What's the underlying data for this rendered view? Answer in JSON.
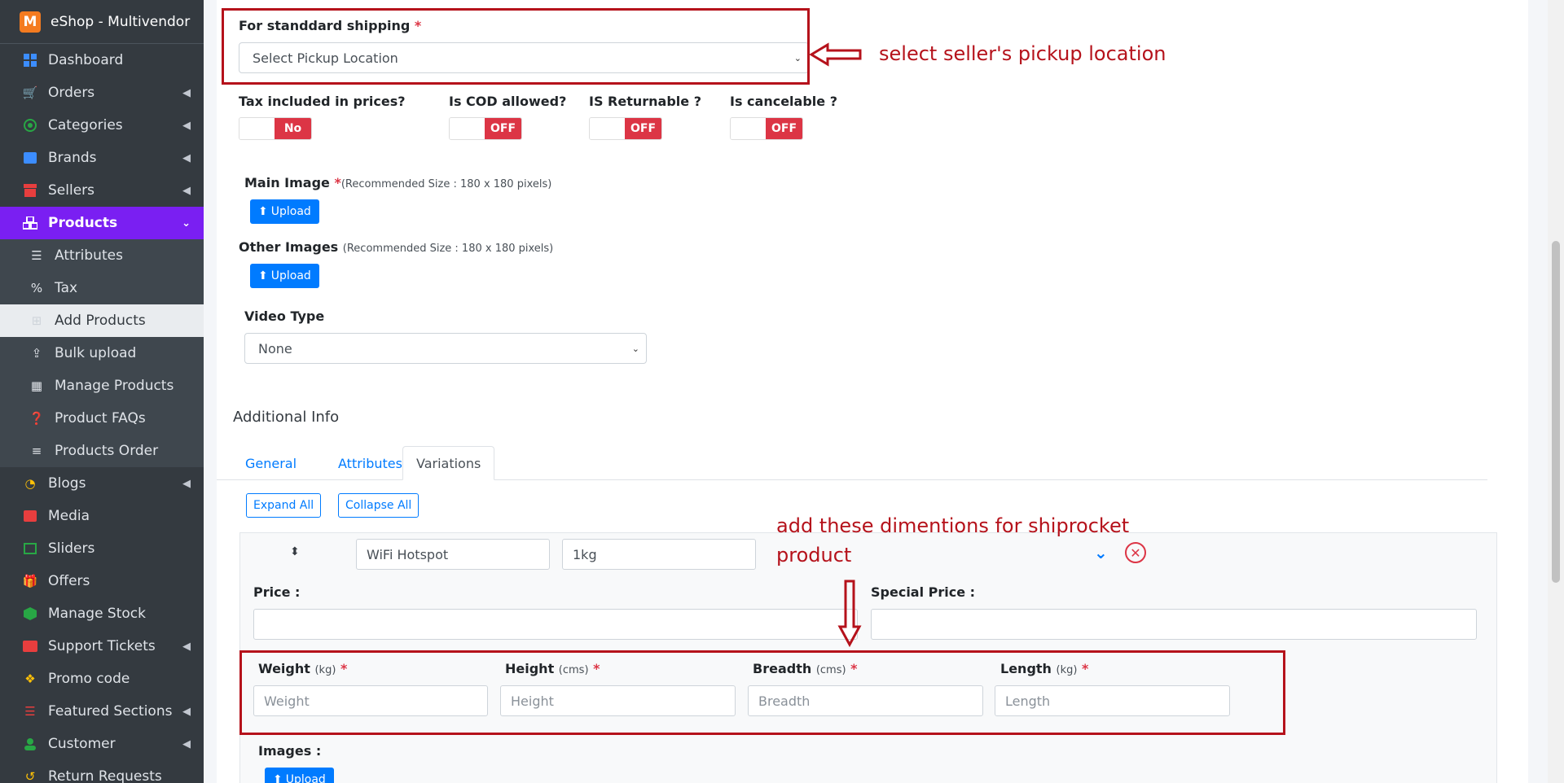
{
  "brand": {
    "title": "eShop - Multivendor",
    "logo_letter": "M"
  },
  "sidebar": {
    "items": [
      {
        "label": "Dashboard",
        "icon": "dashboard-icon"
      },
      {
        "label": "Orders",
        "icon": "cart-icon"
      },
      {
        "label": "Categories",
        "icon": "target-icon"
      },
      {
        "label": "Brands",
        "icon": "ad-icon"
      },
      {
        "label": "Sellers",
        "icon": "store-icon"
      },
      {
        "label": "Products",
        "icon": "cubes-icon"
      },
      {
        "label": "Attributes",
        "icon": "sliders-icon"
      },
      {
        "label": "Tax",
        "icon": "percent-icon"
      },
      {
        "label": "Add Products",
        "icon": "plus-square-icon"
      },
      {
        "label": "Bulk upload",
        "icon": "upload-icon"
      },
      {
        "label": "Manage Products",
        "icon": "boxes-icon"
      },
      {
        "label": "Product FAQs",
        "icon": "question-circle-icon"
      },
      {
        "label": "Products Order",
        "icon": "list-icon"
      },
      {
        "label": "Blogs",
        "icon": "blog-icon"
      },
      {
        "label": "Media",
        "icon": "photo-icon"
      },
      {
        "label": "Sliders",
        "icon": "image-icon"
      },
      {
        "label": "Offers",
        "icon": "gift-icon"
      },
      {
        "label": "Manage Stock",
        "icon": "cube-icon"
      },
      {
        "label": "Support Tickets",
        "icon": "ticket-icon"
      },
      {
        "label": "Promo code",
        "icon": "puzzle-icon"
      },
      {
        "label": "Featured Sections",
        "icon": "layers-icon"
      },
      {
        "label": "Customer",
        "icon": "user-icon"
      },
      {
        "label": "Return Requests",
        "icon": "undo-icon"
      }
    ]
  },
  "form": {
    "shipping_label": "For standdard shipping",
    "required_mark": "*",
    "pickup_select_value": "Select Pickup Location",
    "tax_label": "Tax included in prices?",
    "tax_value": "No",
    "cod_label": "Is COD allowed?",
    "cod_value": "OFF",
    "returnable_label": "IS Returnable ?",
    "returnable_value": "OFF",
    "cancelable_label": "Is cancelable ?",
    "cancelable_value": "OFF",
    "main_image_label": "Main Image",
    "main_image_hint": "(Recommended Size : 180 x 180 pixels)",
    "other_images_label": "Other Images",
    "other_images_hint": "(Recommended Size : 180 x 180 pixels)",
    "upload_label": "Upload",
    "video_type_label": "Video Type",
    "video_type_value": "None",
    "additional_info_title": "Additional Info"
  },
  "tabs": [
    "General",
    "Attributes",
    "Variations"
  ],
  "variations": {
    "expand_all": "Expand All",
    "collapse_all": "Collapse All",
    "attr1_value": "WiFi Hotspot",
    "attr2_value": "1kg",
    "price_label": "Price :",
    "special_price_label": "Special Price :",
    "weight_label": "Weight",
    "weight_unit": "(kg)",
    "weight_placeholder": "Weight",
    "height_label": "Height",
    "height_unit": "(cms)",
    "height_placeholder": "Height",
    "breadth_label": "Breadth",
    "breadth_unit": "(cms)",
    "breadth_placeholder": "Breadth",
    "length_label": "Length",
    "length_unit": "(kg)",
    "length_placeholder": "Length",
    "images_label": "Images :",
    "upload_label": "Upload"
  },
  "annotations": {
    "pickup_note": "select seller's pickup location",
    "dimensions_note_line1": "add these dimentions for shiprocket",
    "dimensions_note_line2": "product"
  },
  "colors": {
    "accent": "#7a1ff2",
    "danger": "#dc3545",
    "primary": "#007bff",
    "annotation": "#b5121b"
  }
}
